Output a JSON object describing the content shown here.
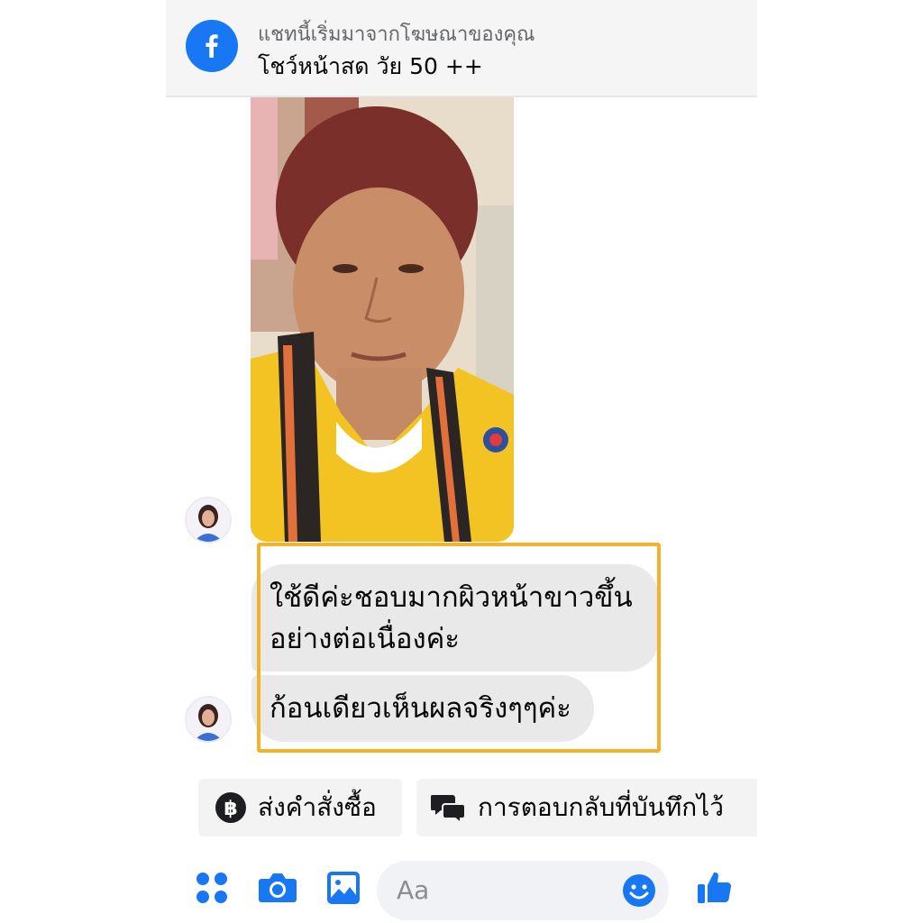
{
  "banner": {
    "subtitle": "แชทนี้เริ่มมาจากโฆษณาของคุณ",
    "title": "โชว์หน้าสด วัย 50 ++",
    "icon": "facebook-logo-icon"
  },
  "messages": [
    {
      "type": "image",
      "description_icon": "photo"
    },
    {
      "type": "text",
      "line1": "ใช้ดีค่ะชอบมากผิวหน้าขาวขึ้น",
      "line2": "อย่างต่อเนื่องค่ะ"
    },
    {
      "type": "text",
      "line1": "ก้อนเดียวเห็นผลจริงๆๆค่ะ"
    }
  ],
  "quick_replies": {
    "order": {
      "label": "ส่งคำสั่งซื้อ",
      "icon": "baht-icon"
    },
    "saved": {
      "label": "การตอบกลับที่บันทึกไว้",
      "icon": "chat-bubbles-icon"
    }
  },
  "composer": {
    "placeholder": "Aa",
    "icons": [
      "menu-dots-icon",
      "camera-icon",
      "gallery-icon",
      "emoji-icon",
      "like-icon"
    ]
  },
  "colors": {
    "accent": "#1877f2",
    "bubble": "#e9e9e9",
    "highlight": "#f4b22c"
  }
}
